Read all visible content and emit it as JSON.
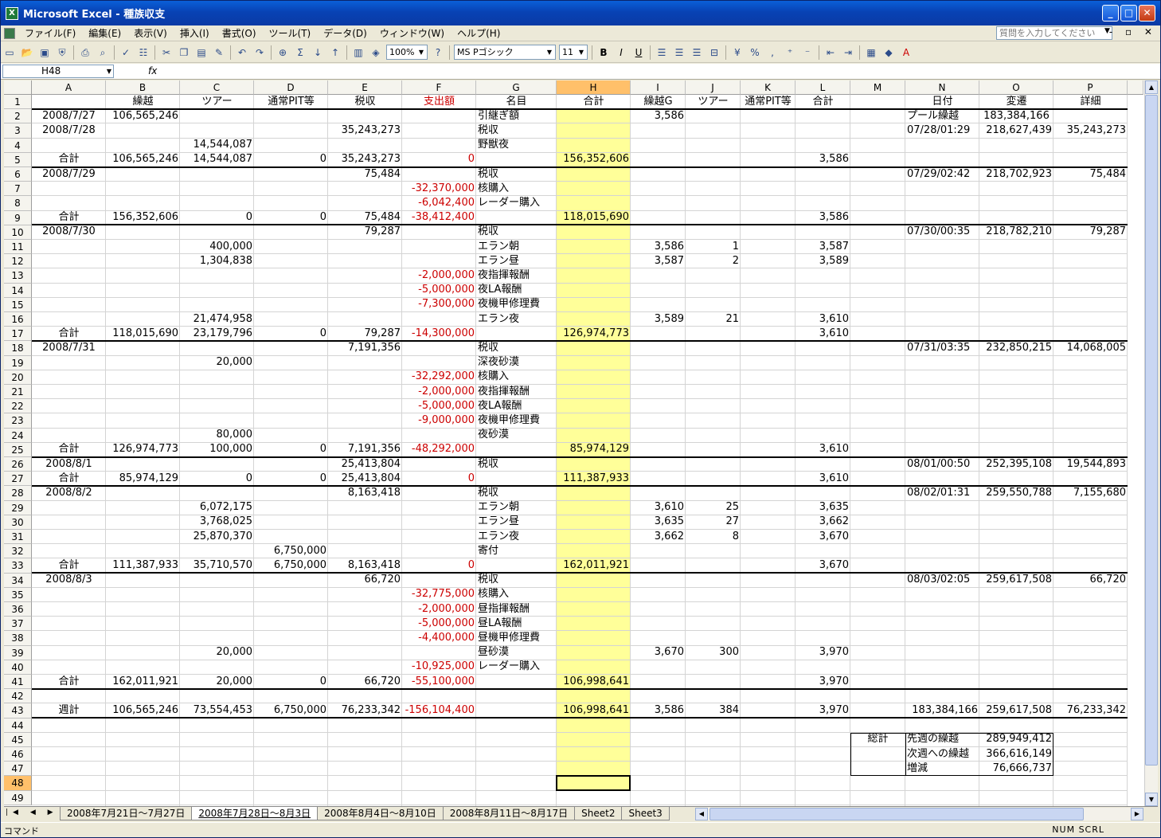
{
  "app": {
    "title": "Microsoft Excel - 種族収支",
    "icon_glyph": "X",
    "help_placeholder": "質問を入力してください"
  },
  "menu": [
    "ファイル(F)",
    "編集(E)",
    "表示(V)",
    "挿入(I)",
    "書式(O)",
    "ツール(T)",
    "データ(D)",
    "ウィンドウ(W)",
    "ヘルプ(H)"
  ],
  "toolbar": {
    "zoom": "100%",
    "font": "MS Pゴシック",
    "size": "11",
    "bold": "B",
    "italic": "I",
    "underline": "U",
    "percent": "%",
    "comma": ","
  },
  "formula": {
    "name": "H48",
    "fx": "fx",
    "content": ""
  },
  "columns": [
    "A",
    "B",
    "C",
    "D",
    "E",
    "F",
    "G",
    "H",
    "I",
    "J",
    "K",
    "L",
    "M",
    "N",
    "O",
    "P"
  ],
  "selected_column": "H",
  "selected_row": 48,
  "rows": [
    {
      "n": 1,
      "cells": {
        "B": "繰越",
        "C": "ツアー",
        "D": "通常PIT等",
        "E": "税収",
        "F": "支出額",
        "G": "名目",
        "H": "合計",
        "I": "繰越G",
        "J": "ツアー",
        "K": "通常PIT等",
        "L": "合計",
        "N": "日付",
        "O": "変遷",
        "P": "詳細"
      }
    },
    {
      "n": 2,
      "cells": {
        "A": "2008/7/27",
        "B": "106,565,246",
        "G": "引継ぎ額",
        "I": "3,586",
        "N": "プール繰越",
        "O": "183,384,166"
      }
    },
    {
      "n": 3,
      "cells": {
        "A": "2008/7/28",
        "E": "35,243,273",
        "G": "税収",
        "N": "07/28/01:29",
        "O": "218,627,439",
        "P": "35,243,273"
      }
    },
    {
      "n": 4,
      "cells": {
        "C": "14,544,087",
        "G": "野獣夜"
      }
    },
    {
      "n": 5,
      "cells": {
        "A": "合計",
        "B": "106,565,246",
        "C": "14,544,087",
        "D": "0",
        "E": "35,243,273",
        "F": "0",
        "H": "156,352,606",
        "L": "3,586"
      }
    },
    {
      "n": 6,
      "cells": {
        "A": "2008/7/29",
        "E": "75,484",
        "G": "税収",
        "N": "07/29/02:42",
        "O": "218,702,923",
        "P": "75,484"
      }
    },
    {
      "n": 7,
      "cells": {
        "F": "-32,370,000",
        "G": "核購入"
      }
    },
    {
      "n": 8,
      "cells": {
        "F": "-6,042,400",
        "G": "レーダー購入"
      }
    },
    {
      "n": 9,
      "cells": {
        "A": "合計",
        "B": "156,352,606",
        "C": "0",
        "D": "0",
        "E": "75,484",
        "F": "-38,412,400",
        "H": "118,015,690",
        "L": "3,586"
      }
    },
    {
      "n": 10,
      "cells": {
        "A": "2008/7/30",
        "E": "79,287",
        "G": "税収",
        "N": "07/30/00:35",
        "O": "218,782,210",
        "P": "79,287"
      }
    },
    {
      "n": 11,
      "cells": {
        "C": "400,000",
        "G": "エラン朝",
        "I": "3,586",
        "J": "1",
        "L": "3,587"
      }
    },
    {
      "n": 12,
      "cells": {
        "C": "1,304,838",
        "G": "エラン昼",
        "I": "3,587",
        "J": "2",
        "L": "3,589"
      }
    },
    {
      "n": 13,
      "cells": {
        "F": "-2,000,000",
        "G": "夜指揮報酬"
      }
    },
    {
      "n": 14,
      "cells": {
        "F": "-5,000,000",
        "G": "夜LA報酬"
      }
    },
    {
      "n": 15,
      "cells": {
        "F": "-7,300,000",
        "G": "夜機甲修理費"
      }
    },
    {
      "n": 16,
      "cells": {
        "C": "21,474,958",
        "G": "エラン夜",
        "I": "3,589",
        "J": "21",
        "L": "3,610"
      }
    },
    {
      "n": 17,
      "cells": {
        "A": "合計",
        "B": "118,015,690",
        "C": "23,179,796",
        "D": "0",
        "E": "79,287",
        "F": "-14,300,000",
        "H": "126,974,773",
        "L": "3,610"
      }
    },
    {
      "n": 18,
      "cells": {
        "A": "2008/7/31",
        "E": "7,191,356",
        "G": "税収",
        "N": "07/31/03:35",
        "O": "232,850,215",
        "P": "14,068,005"
      }
    },
    {
      "n": 19,
      "cells": {
        "C": "20,000",
        "G": "深夜砂漠"
      }
    },
    {
      "n": 20,
      "cells": {
        "F": "-32,292,000",
        "G": "核購入"
      }
    },
    {
      "n": 21,
      "cells": {
        "F": "-2,000,000",
        "G": "夜指揮報酬"
      }
    },
    {
      "n": 22,
      "cells": {
        "F": "-5,000,000",
        "G": "夜LA報酬"
      }
    },
    {
      "n": 23,
      "cells": {
        "F": "-9,000,000",
        "G": "夜機甲修理費"
      }
    },
    {
      "n": 24,
      "cells": {
        "C": "80,000",
        "G": "夜砂漠"
      }
    },
    {
      "n": 25,
      "cells": {
        "A": "合計",
        "B": "126,974,773",
        "C": "100,000",
        "D": "0",
        "E": "7,191,356",
        "F": "-48,292,000",
        "H": "85,974,129",
        "L": "3,610"
      }
    },
    {
      "n": 26,
      "cells": {
        "A": "2008/8/1",
        "E": "25,413,804",
        "G": "税収",
        "N": "08/01/00:50",
        "O": "252,395,108",
        "P": "19,544,893"
      }
    },
    {
      "n": 27,
      "cells": {
        "A": "合計",
        "B": "85,974,129",
        "C": "0",
        "D": "0",
        "E": "25,413,804",
        "F": "0",
        "H": "111,387,933",
        "L": "3,610"
      }
    },
    {
      "n": 28,
      "cells": {
        "A": "2008/8/2",
        "E": "8,163,418",
        "G": "税収",
        "N": "08/02/01:31",
        "O": "259,550,788",
        "P": "7,155,680"
      }
    },
    {
      "n": 29,
      "cells": {
        "C": "6,072,175",
        "G": "エラン朝",
        "I": "3,610",
        "J": "25",
        "L": "3,635"
      }
    },
    {
      "n": 30,
      "cells": {
        "C": "3,768,025",
        "G": "エラン昼",
        "I": "3,635",
        "J": "27",
        "L": "3,662"
      }
    },
    {
      "n": 31,
      "cells": {
        "C": "25,870,370",
        "G": "エラン夜",
        "I": "3,662",
        "J": "8",
        "L": "3,670"
      }
    },
    {
      "n": 32,
      "cells": {
        "D": "6,750,000",
        "G": "寄付"
      }
    },
    {
      "n": 33,
      "cells": {
        "A": "合計",
        "B": "111,387,933",
        "C": "35,710,570",
        "D": "6,750,000",
        "E": "8,163,418",
        "F": "0",
        "H": "162,011,921",
        "L": "3,670"
      }
    },
    {
      "n": 34,
      "cells": {
        "A": "2008/8/3",
        "E": "66,720",
        "G": "税収",
        "N": "08/03/02:05",
        "O": "259,617,508",
        "P": "66,720"
      }
    },
    {
      "n": 35,
      "cells": {
        "F": "-32,775,000",
        "G": "核購入"
      }
    },
    {
      "n": 36,
      "cells": {
        "F": "-2,000,000",
        "G": "昼指揮報酬"
      }
    },
    {
      "n": 37,
      "cells": {
        "F": "-5,000,000",
        "G": "昼LA報酬"
      }
    },
    {
      "n": 38,
      "cells": {
        "F": "-4,400,000",
        "G": "昼機甲修理費"
      }
    },
    {
      "n": 39,
      "cells": {
        "C": "20,000",
        "G": "昼砂漠",
        "I": "3,670",
        "J": "300",
        "L": "3,970"
      }
    },
    {
      "n": 40,
      "cells": {
        "F": "-10,925,000",
        "G": "レーダー購入"
      }
    },
    {
      "n": 41,
      "cells": {
        "A": "合計",
        "B": "162,011,921",
        "C": "20,000",
        "D": "0",
        "E": "66,720",
        "F": "-55,100,000",
        "H": "106,998,641",
        "L": "3,970"
      }
    },
    {
      "n": 42,
      "cells": {}
    },
    {
      "n": 43,
      "cells": {
        "A": "週計",
        "B": "106,565,246",
        "C": "73,554,453",
        "D": "6,750,000",
        "E": "76,233,342",
        "F": "-156,104,400",
        "H": "106,998,641",
        "I": "3,586",
        "J": "384",
        "L": "3,970",
        "N": "183,384,166",
        "O": "259,617,508",
        "P": "76,233,342"
      }
    },
    {
      "n": 44,
      "cells": {}
    },
    {
      "n": 45,
      "cells": {
        "M": "総計",
        "N": "先週の繰越",
        "O": "289,949,412"
      }
    },
    {
      "n": 46,
      "cells": {
        "N": "次週への繰越",
        "O": "366,616,149"
      }
    },
    {
      "n": 47,
      "cells": {
        "N": "増減",
        "O": "76,666,737"
      }
    },
    {
      "n": 48,
      "cells": {}
    },
    {
      "n": 49,
      "cells": {}
    }
  ],
  "sheets": [
    "2008年7月21日～7月27日",
    "2008年7月28日～8月3日",
    "2008年8月4日～8月10日",
    "2008年8月11日～8月17日",
    "Sheet2",
    "Sheet3"
  ],
  "active_sheet": 1,
  "status": {
    "mode": "コマンド",
    "indicators": "NUM  SCRL"
  },
  "colors": {
    "highlight_column": "#ffff99",
    "selected_header": "#ffc06a",
    "negative": "#cc0000",
    "titlebar": "#0a5fd8"
  }
}
